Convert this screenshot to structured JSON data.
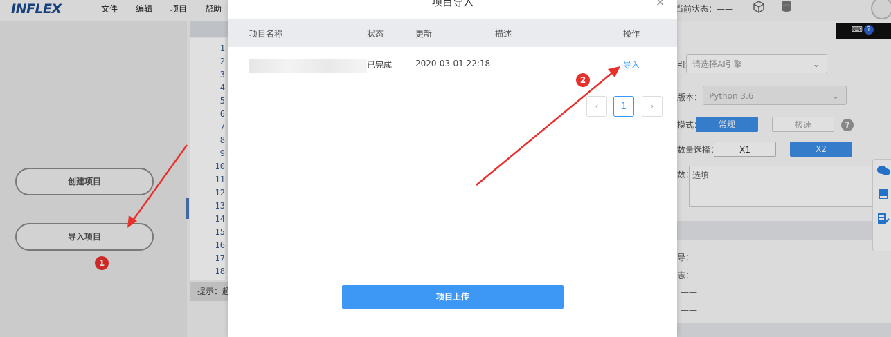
{
  "app": {
    "logo": "INFLEX",
    "menu": [
      "文件",
      "编辑",
      "项目",
      "帮助"
    ],
    "status_label": "当前状态：——"
  },
  "left_panel": {
    "create_project": "创建项目",
    "import_project": "导入项目",
    "badge_1": "1"
  },
  "editor": {
    "line_numbers": [
      "1",
      "2",
      "3",
      "4",
      "5",
      "6",
      "7",
      "8",
      "9",
      "10",
      "11",
      "12",
      "13",
      "14",
      "15",
      "16",
      "17",
      "18"
    ],
    "tip_label": "提示：超"
  },
  "right_panel": {
    "engine_label": "引擎：",
    "engine_placeholder": "请选择AI引擎",
    "version_label": "版本：",
    "version_value": "Python 3.6",
    "mode_label": "模式：",
    "mode_normal": "常规",
    "mode_fast": "极速",
    "count_label": "数量选择：",
    "count_x1": "X1",
    "count_x2": "X2",
    "param_label": "数：",
    "param_placeholder": "选填",
    "info1": "导：——",
    "info2": "志：——",
    "info3": "——",
    "info4": "——"
  },
  "modal": {
    "title": "项目导入",
    "columns": {
      "name": "项目名称",
      "status": "状态",
      "updated": "更新",
      "desc": "描述",
      "action": "操作"
    },
    "rows": [
      {
        "name": "",
        "status": "已完成",
        "updated": "2020-03-01 22:18",
        "desc": "",
        "action": "导入"
      }
    ],
    "pagination": {
      "prev": "‹",
      "current": "1",
      "next": "›"
    },
    "upload_button": "项目上传",
    "badge_2": "2"
  },
  "colors": {
    "primary": "#3d98f5",
    "link": "#3d98f5",
    "badge": "#e8302d",
    "arrow": "#e8302d"
  }
}
